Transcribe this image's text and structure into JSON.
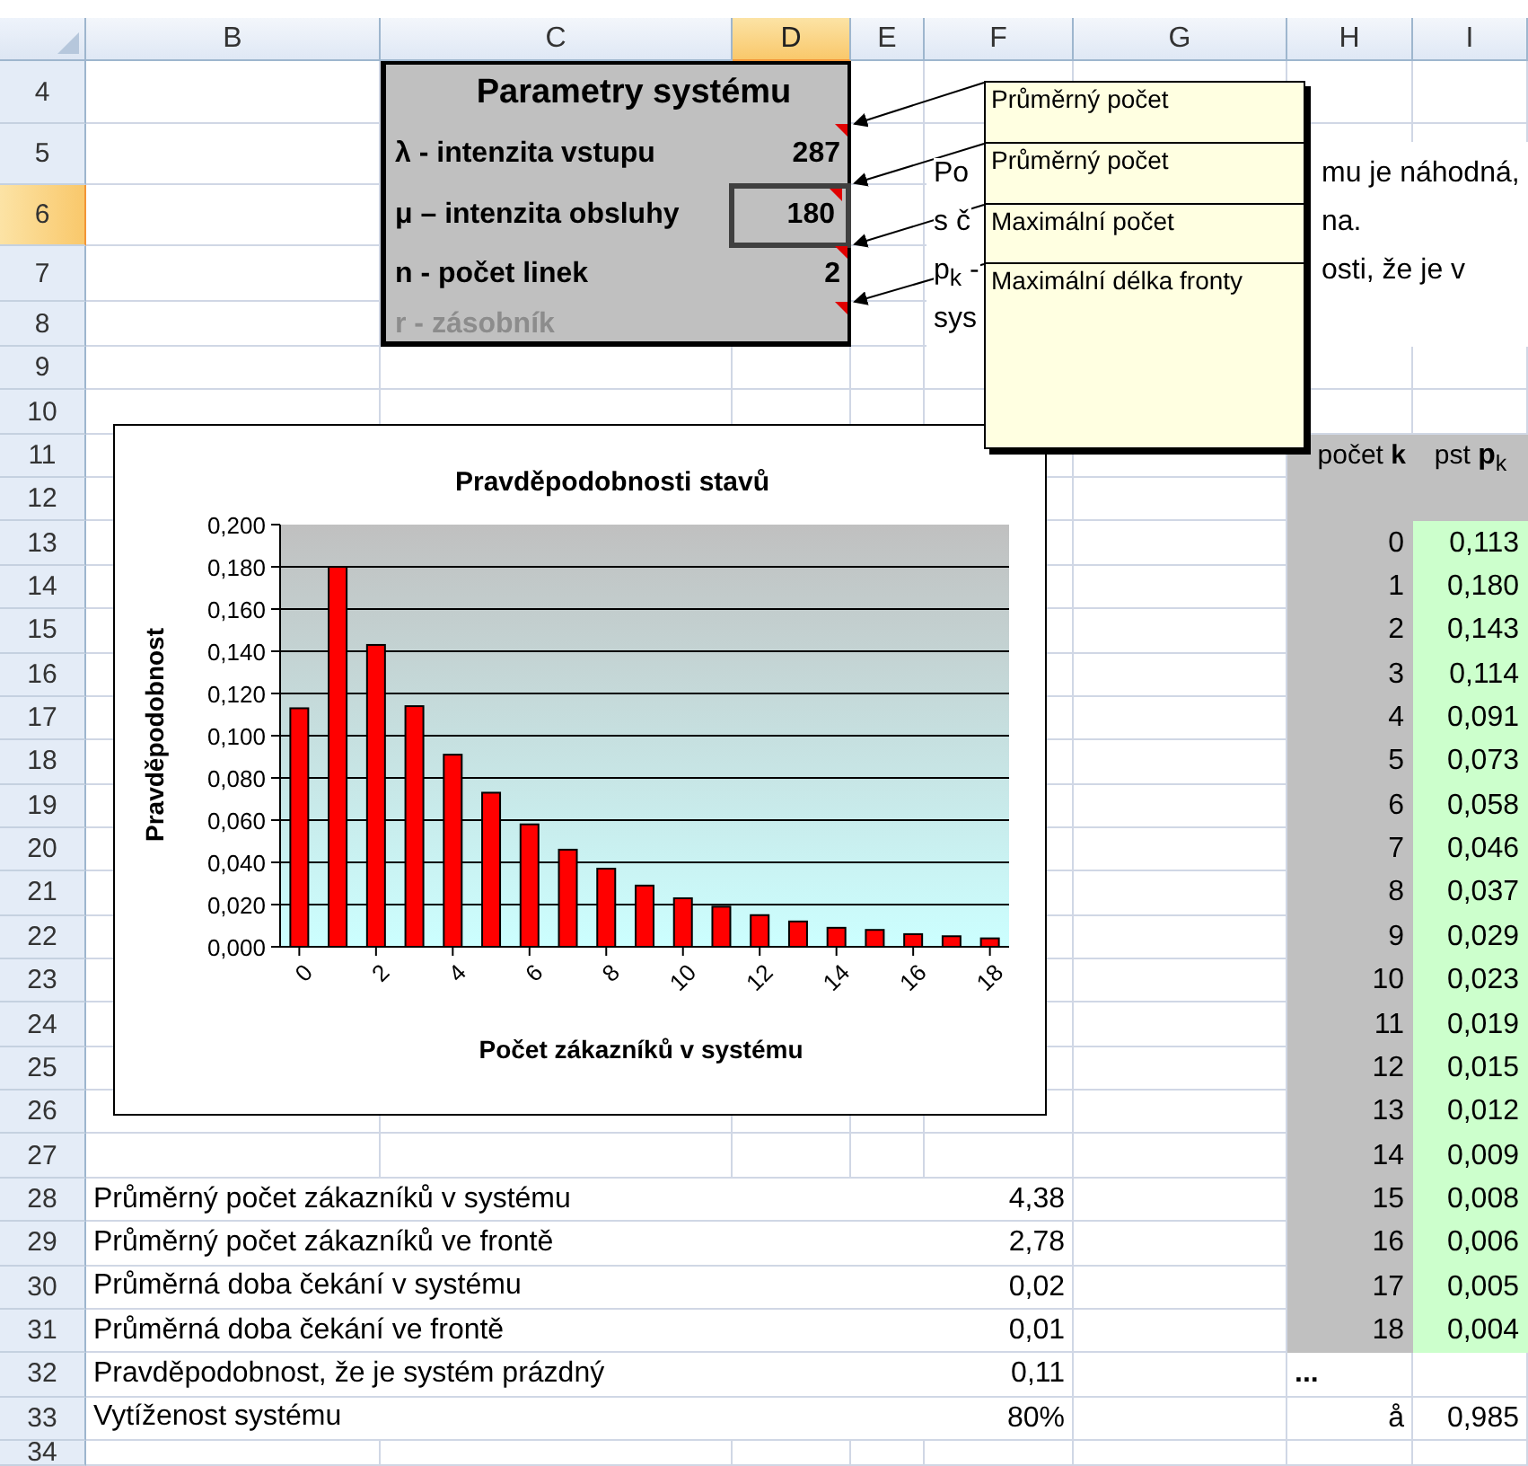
{
  "sheet": {
    "columns": [
      {
        "label": "B",
        "selected": false
      },
      {
        "label": "C",
        "selected": false
      },
      {
        "label": "D",
        "selected": true
      },
      {
        "label": "E",
        "selected": false
      },
      {
        "label": "F",
        "selected": false
      },
      {
        "label": "G",
        "selected": false
      },
      {
        "label": "H",
        "selected": false
      },
      {
        "label": "I",
        "selected": false
      }
    ],
    "rows": [
      {
        "label": "4",
        "selected": false
      },
      {
        "label": "5",
        "selected": false
      },
      {
        "label": "6",
        "selected": true
      },
      {
        "label": "7",
        "selected": false
      },
      {
        "label": "8",
        "selected": false
      },
      {
        "label": "9",
        "selected": false
      },
      {
        "label": "10",
        "selected": false
      },
      {
        "label": "11",
        "selected": false
      },
      {
        "label": "12",
        "selected": false
      },
      {
        "label": "13",
        "selected": false
      },
      {
        "label": "14",
        "selected": false
      },
      {
        "label": "15",
        "selected": false
      },
      {
        "label": "16",
        "selected": false
      },
      {
        "label": "17",
        "selected": false
      },
      {
        "label": "18",
        "selected": false
      },
      {
        "label": "19",
        "selected": false
      },
      {
        "label": "20",
        "selected": false
      },
      {
        "label": "21",
        "selected": false
      },
      {
        "label": "22",
        "selected": false
      },
      {
        "label": "23",
        "selected": false
      },
      {
        "label": "24",
        "selected": false
      },
      {
        "label": "25",
        "selected": false
      },
      {
        "label": "26",
        "selected": false
      },
      {
        "label": "27",
        "selected": false
      },
      {
        "label": "28",
        "selected": false
      },
      {
        "label": "29",
        "selected": false
      },
      {
        "label": "30",
        "selected": false
      },
      {
        "label": "31",
        "selected": false
      },
      {
        "label": "32",
        "selected": false
      },
      {
        "label": "33",
        "selected": false
      },
      {
        "label": "34",
        "selected": false
      }
    ]
  },
  "parameters": {
    "title": "Parametry systému",
    "items": [
      {
        "label": "λ - intenzita vstupu",
        "value": "287",
        "disabled": false,
        "selected": false
      },
      {
        "label": "μ – intenzita obsluhy",
        "value": "180",
        "disabled": false,
        "selected": true
      },
      {
        "label": "n - počet linek",
        "value": "2",
        "disabled": false,
        "selected": false
      },
      {
        "label": "r - zásobník",
        "disabled": true,
        "selected": false
      }
    ]
  },
  "comments": [
    {
      "lines": [
        "Průměrný počet"
      ]
    },
    {
      "lines": [
        "Průměrný počet"
      ]
    },
    {
      "lines": [
        "Maximální počet"
      ]
    },
    {
      "lines": [
        "Maximální délka fronty"
      ]
    }
  ],
  "note_lines": [
    {
      "left": "Po",
      "right": "mu je náhodná,"
    },
    {
      "left": "s č",
      "right": "na."
    },
    {
      "left": "p$_{k}$ -",
      "right": "osti, že je v"
    },
    {
      "left": "sys"
    }
  ],
  "chart": {
    "chart_data": {
      "type": "bar",
      "title": "Pravděpodobnosti  stavů",
      "xlabel": "Počet zákazníků  v systému",
      "ylabel": "Pravděpodobnost",
      "x": [
        0,
        1,
        2,
        3,
        4,
        5,
        6,
        7,
        8,
        9,
        10,
        11,
        12,
        13,
        14,
        15,
        16,
        17,
        18
      ],
      "grid": true,
      "xlim": [
        -0.5,
        18.5
      ],
      "series": [
        {
          "color": "#ff0000",
          "values": [
            0.113,
            0.18,
            0.143,
            0.114,
            0.091,
            0.073,
            0.058,
            0.046,
            0.037,
            0.029,
            0.023,
            0.019,
            0.015,
            0.012,
            0.009,
            0.008,
            0.006,
            0.005,
            0.004
          ]
        }
      ],
      "ylim": [
        0,
        0.2
      ],
      "yticks": [
        {
          "value": 0,
          "label": "0,000"
        },
        {
          "value": 0.02,
          "label": "0,020"
        },
        {
          "value": 0.04,
          "label": "0,040"
        },
        {
          "value": 0.06,
          "label": "0,060"
        },
        {
          "value": 0.08,
          "label": "0,080"
        },
        {
          "value": 0.1,
          "label": "0,100"
        },
        {
          "value": 0.12,
          "label": "0,120"
        },
        {
          "value": 0.14,
          "label": "0,140"
        },
        {
          "value": 0.16,
          "label": "0,160"
        },
        {
          "value": 0.18,
          "label": "0,180"
        },
        {
          "value": 0.2,
          "label": "0,200"
        }
      ],
      "xticks": [
        0,
        2,
        4,
        6,
        8,
        10,
        12,
        14,
        16,
        18
      ]
    }
  },
  "probability_table": {
    "header_k": "počet **k**",
    "header_p": "pst **p**$_{k}$",
    "rows": [
      {
        "k": "0",
        "p": "0,113"
      },
      {
        "k": "1",
        "p": "0,180"
      },
      {
        "k": "2",
        "p": "0,143"
      },
      {
        "k": "3",
        "p": "0,114"
      },
      {
        "k": "4",
        "p": "0,091"
      },
      {
        "k": "5",
        "p": "0,073"
      },
      {
        "k": "6",
        "p": "0,058"
      },
      {
        "k": "7",
        "p": "0,046"
      },
      {
        "k": "8",
        "p": "0,037"
      },
      {
        "k": "9",
        "p": "0,029"
      },
      {
        "k": "10",
        "p": "0,023"
      },
      {
        "k": "11",
        "p": "0,019"
      },
      {
        "k": "12",
        "p": "0,015"
      },
      {
        "k": "13",
        "p": "0,012"
      },
      {
        "k": "14",
        "p": "0,009"
      },
      {
        "k": "15",
        "p": "0,008"
      },
      {
        "k": "16",
        "p": "0,006"
      },
      {
        "k": "17",
        "p": "0,005"
      },
      {
        "k": "18",
        "p": "0,004"
      }
    ],
    "ellipsis": "...",
    "sum_symbol": "å",
    "sum": "0,985"
  },
  "summary": [
    {
      "label": "Průměrný počet zákazníků v systému",
      "value": "4,38"
    },
    {
      "label": "Průměrný počet zákazníků ve frontě",
      "value": "2,78"
    },
    {
      "label": "Průměrná doba čekání v systému",
      "value": "0,02"
    },
    {
      "label": "Průměrná doba čekání ve frontě",
      "value": "0,01"
    },
    {
      "label": "Pravděpodobnost, že je systém prázdný",
      "value": "0,11"
    },
    {
      "label": "Vytíženost systému",
      "value": "80%"
    }
  ]
}
